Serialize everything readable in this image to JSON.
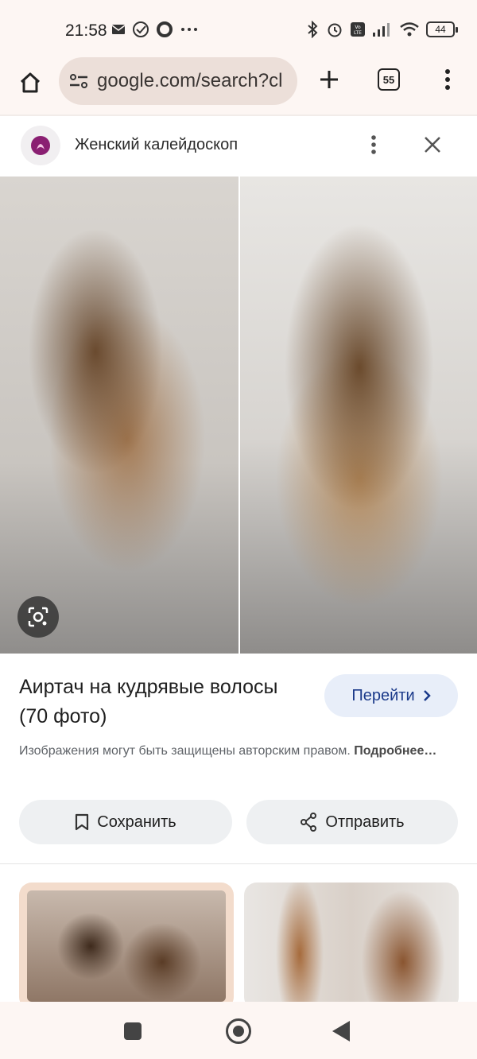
{
  "status_bar": {
    "time": "21:58",
    "left_icons": [
      "mail-icon",
      "check-circle-icon",
      "circle-icon",
      "more-dots-icon"
    ],
    "right_icons": [
      "bluetooth-icon",
      "alarm-icon",
      "volte-icon",
      "signal-icon",
      "wifi-icon"
    ],
    "battery": "44"
  },
  "browser": {
    "url": "google.com/search?cl",
    "tab_count": "55"
  },
  "site": {
    "name": "Женский калейдоскоп"
  },
  "result": {
    "title": "Аиртач на кудрявые волосы (70 фото)",
    "visit_label": "Перейти",
    "copyright_text": "Изображения могут быть защищены авторским правом.",
    "more_label": "Подробнее…",
    "save_label": "Сохранить",
    "share_label": "Отправить"
  },
  "colors": {
    "accent": "#1b3a8a",
    "chip_bg": "#e8eef9",
    "button_bg": "#eef0f2",
    "chrome_bg": "#fdf6f3",
    "url_bg": "#ecdfd9"
  }
}
